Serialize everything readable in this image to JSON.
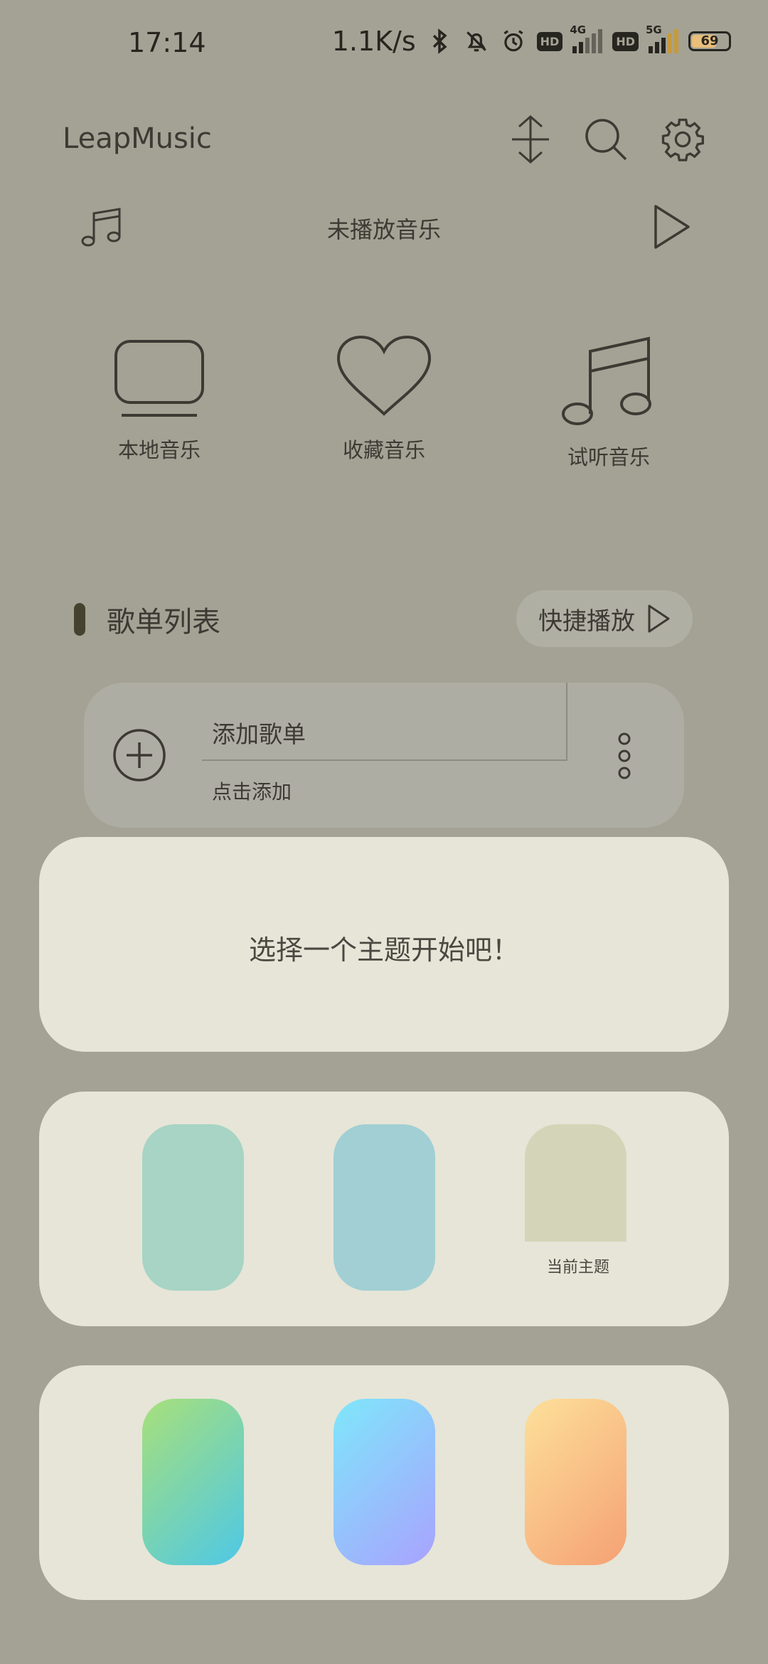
{
  "status_bar": {
    "time": "17:14",
    "net_speed": "1.1K/s",
    "icons": [
      "bluetooth-icon",
      "bell-off-icon",
      "alarm-icon",
      "hd-icon",
      "signal-4g-icon",
      "hd-icon",
      "signal-5g-icon",
      "battery-icon"
    ],
    "hd_label": "HD",
    "sim1_tag": "4G",
    "sim2_tag": "5G",
    "battery_level": "69"
  },
  "header": {
    "app_name": "LeapMusic",
    "icons": [
      "sort-icon",
      "search-icon",
      "gear-icon"
    ]
  },
  "now_playing": {
    "icon": "music-note-icon",
    "text": "未播放音乐",
    "play_icon": "play-icon"
  },
  "categories": [
    {
      "label": "本地音乐",
      "icon": "monitor-icon"
    },
    {
      "label": "收藏音乐",
      "icon": "heart-icon"
    },
    {
      "label": "试听音乐",
      "icon": "music-notes-icon"
    }
  ],
  "playlist_section": {
    "title": "歌单列表",
    "quick_play_label": "快捷播放"
  },
  "add_playlist": {
    "title": "添加歌单",
    "subtitle": "点击添加",
    "icon": "plus-circle-icon",
    "more_icon": "more-vertical-icon"
  },
  "theme_picker": {
    "prompt": "选择一个主题开始吧！",
    "current_label": "当前主题",
    "solid_themes": [
      "#a7d4c4",
      "#a1cfd4",
      "#d4d5b8"
    ],
    "gradient_themes": [
      {
        "from": "#a8e07a",
        "to": "#4ec8e6"
      },
      {
        "from": "#7ee7fa",
        "to": "#a9a2fe"
      },
      {
        "from": "#fde09a",
        "to": "#f5a174"
      }
    ]
  },
  "colors": {
    "background": "#a3a295",
    "panel": "#e6e5d8",
    "text": "#3c3a33"
  }
}
